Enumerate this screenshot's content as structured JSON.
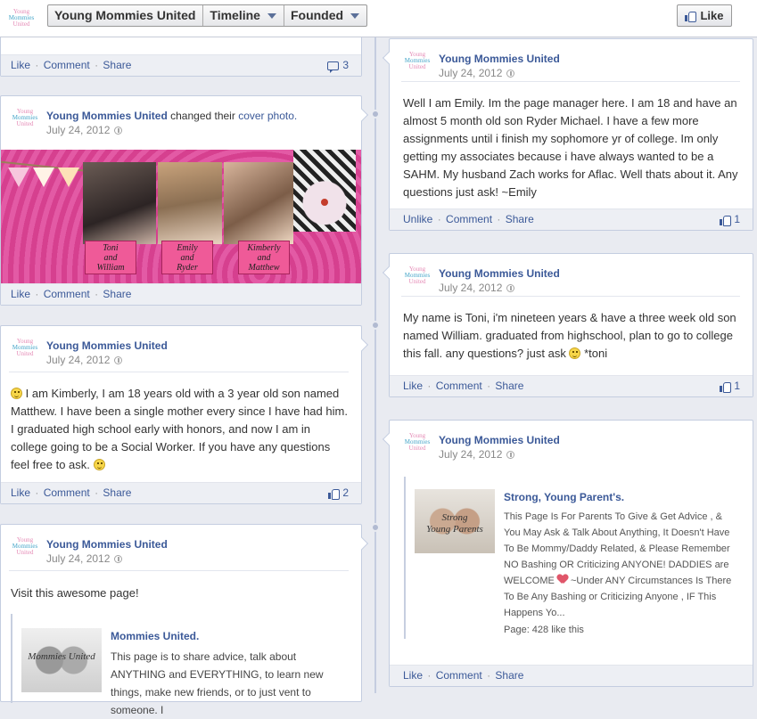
{
  "header": {
    "logo": [
      "Young",
      "Mommies",
      "United"
    ],
    "crumbs": [
      "Young Mommies United",
      "Timeline",
      "Founded"
    ],
    "like_button": "Like"
  },
  "actions": {
    "like": "Like",
    "unlike": "Unlike",
    "comment": "Comment",
    "share": "Share",
    "sep": "·"
  },
  "page_name": "Young Mommies United",
  "post_date": "July 24, 2012",
  "posts": {
    "top_left": {
      "count": "3"
    },
    "cover": {
      "changed_text": "changed their",
      "cover_link": "cover photo.",
      "tags": [
        [
          "Toni",
          "and",
          "William"
        ],
        [
          "Emily",
          "and",
          "Ryder"
        ],
        [
          "Kimberly",
          "and",
          "Matthew"
        ]
      ]
    },
    "kimberly": {
      "text": "I am Kimberly, I am 18 years old with a 3 year old son named Matthew. I have been a single mother every since I have had him. I graduated high school early with honors, and now I am in college going to be a Social Worker. If you have any questions feel free to ask.",
      "count": "2"
    },
    "visit": {
      "text": "Visit this awesome page!",
      "share_title": "Mommies United.",
      "share_desc": "This page is to share advice, talk about ANYTHING and EVERYTHING, to learn new things, make new friends, or to just vent to someone. I",
      "thumb_text": "Mommies United"
    },
    "emily": {
      "text": "Well I am Emily. Im the page manager here. I am 18 and have an almost 5 month old son Ryder Michael. I have a few more assignments until i finish my sophomore yr of college. Im only getting my associates because i have always wanted to be a SAHM. My husband Zach works for Aflac. Well thats about it. Any questions just ask! ~Emily",
      "count": "1"
    },
    "toni": {
      "text_before": "My name is Toni, i'm nineteen years & have a three week old son named William. graduated from highschool, plan to go to college this fall. any questions? just ask",
      "text_after": "*toni",
      "count": "1"
    },
    "strong": {
      "share_title": "Strong, Young Parent's.",
      "share_desc_before": "This Page Is For Parents To Give & Get Advice , & You May Ask & Talk About Anything, It Doesn't Have To Be Mommy/Daddy Related, & Please Remember NO Bashing OR Criticizing ANYONE! DADDIES are WELCOME",
      "share_desc_after": "~Under ANY Circumstances Is There To Be Any Bashing or Criticizing Anyone , IF This Happens Yo...",
      "page_likes": "Page: 428 like this",
      "thumb_text": [
        "Strong",
        "Young Parents"
      ]
    }
  },
  "colors": {
    "link": "#3b5998",
    "pink": "#e35aa5",
    "background": "#e9ebf1"
  }
}
